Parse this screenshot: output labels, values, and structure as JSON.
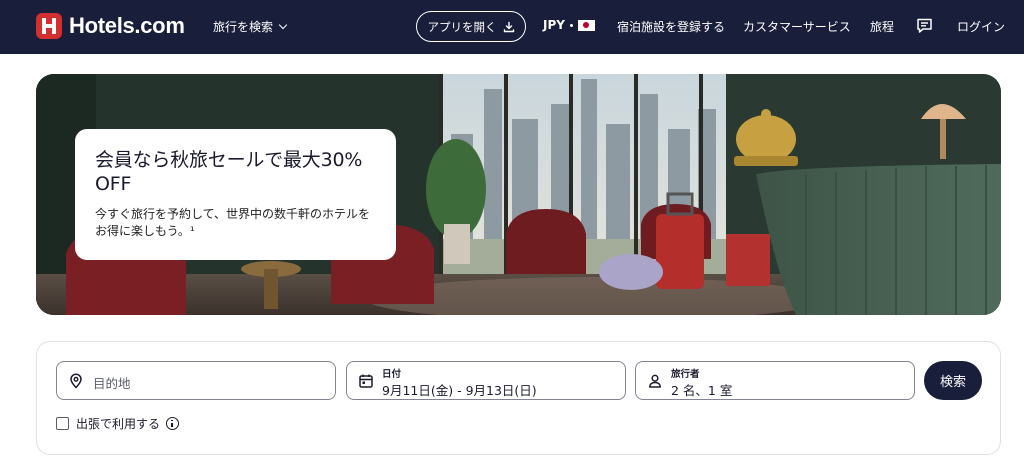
{
  "brand": {
    "name": "Hotels.com",
    "color": "#d32f2f"
  },
  "nav": {
    "background": "#191e3b",
    "search_trips": "旅行を検索",
    "open_app": "アプリを開く",
    "currency": "JPY",
    "list_property": "宿泊施設を登録する",
    "support": "カスタマーサービス",
    "trips": "旅程",
    "messages_icon": "message-icon",
    "sign_in": "ログイン"
  },
  "hero": {
    "title": "会員なら秋旅セールで最大30% OFF",
    "subtitle": "今すぐ旅行を予約して、世界中の数千軒のホテルをお得に楽しもう。¹"
  },
  "search": {
    "destination": {
      "placeholder": "目的地",
      "icon": "location-pin-icon"
    },
    "dates": {
      "label": "日付",
      "value": "9月11日(金) - 9月13日(日)",
      "icon": "calendar-icon"
    },
    "travelers": {
      "label": "旅行者",
      "value": "2 名、1 室",
      "icon": "person-icon"
    },
    "submit": "検索",
    "business_travel": "出張で利用する"
  }
}
